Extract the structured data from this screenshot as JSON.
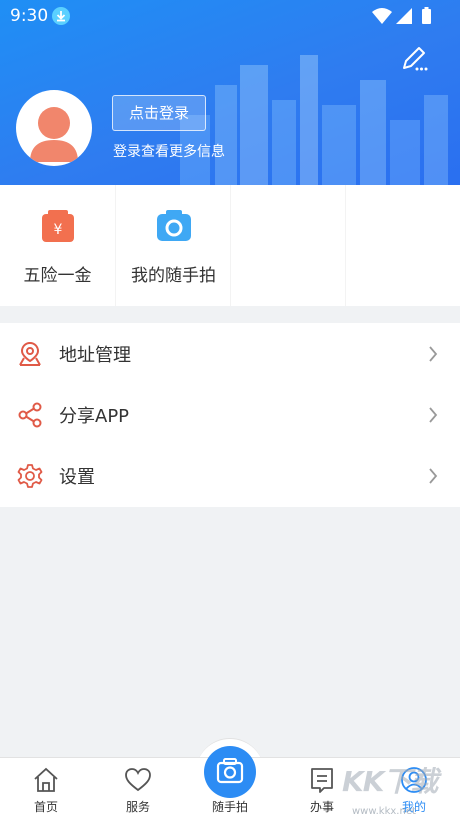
{
  "status_bar": {
    "time": "9:30"
  },
  "header": {
    "login_button": "点击登录",
    "login_subtitle": "登录查看更多信息"
  },
  "quick_actions": [
    {
      "label": "五险一金",
      "icon": "money-bag-icon",
      "color": "#f2704f"
    },
    {
      "label": "我的随手拍",
      "icon": "camera-icon",
      "color": "#3fa8f4"
    }
  ],
  "menu": [
    {
      "label": "地址管理",
      "icon": "location-pin-icon"
    },
    {
      "label": "分享APP",
      "icon": "share-icon"
    },
    {
      "label": "设置",
      "icon": "gear-icon"
    }
  ],
  "tabbar": {
    "tabs": [
      {
        "label": "首页",
        "icon": "home-icon",
        "active": false
      },
      {
        "label": "服务",
        "icon": "heart-icon",
        "active": false
      },
      {
        "label": "随手拍",
        "icon": "camera-icon",
        "active": false
      },
      {
        "label": "办事",
        "icon": "document-icon",
        "active": false
      },
      {
        "label": "我的",
        "icon": "user-icon",
        "active": true
      }
    ]
  },
  "watermark": {
    "text": "KK下载",
    "url": "www.kkx.net"
  },
  "colors": {
    "header": "#2f7cf0",
    "accent": "#2c8cf4",
    "menu_icon": "#e05a47",
    "active_tab": "#2c8cf4"
  }
}
